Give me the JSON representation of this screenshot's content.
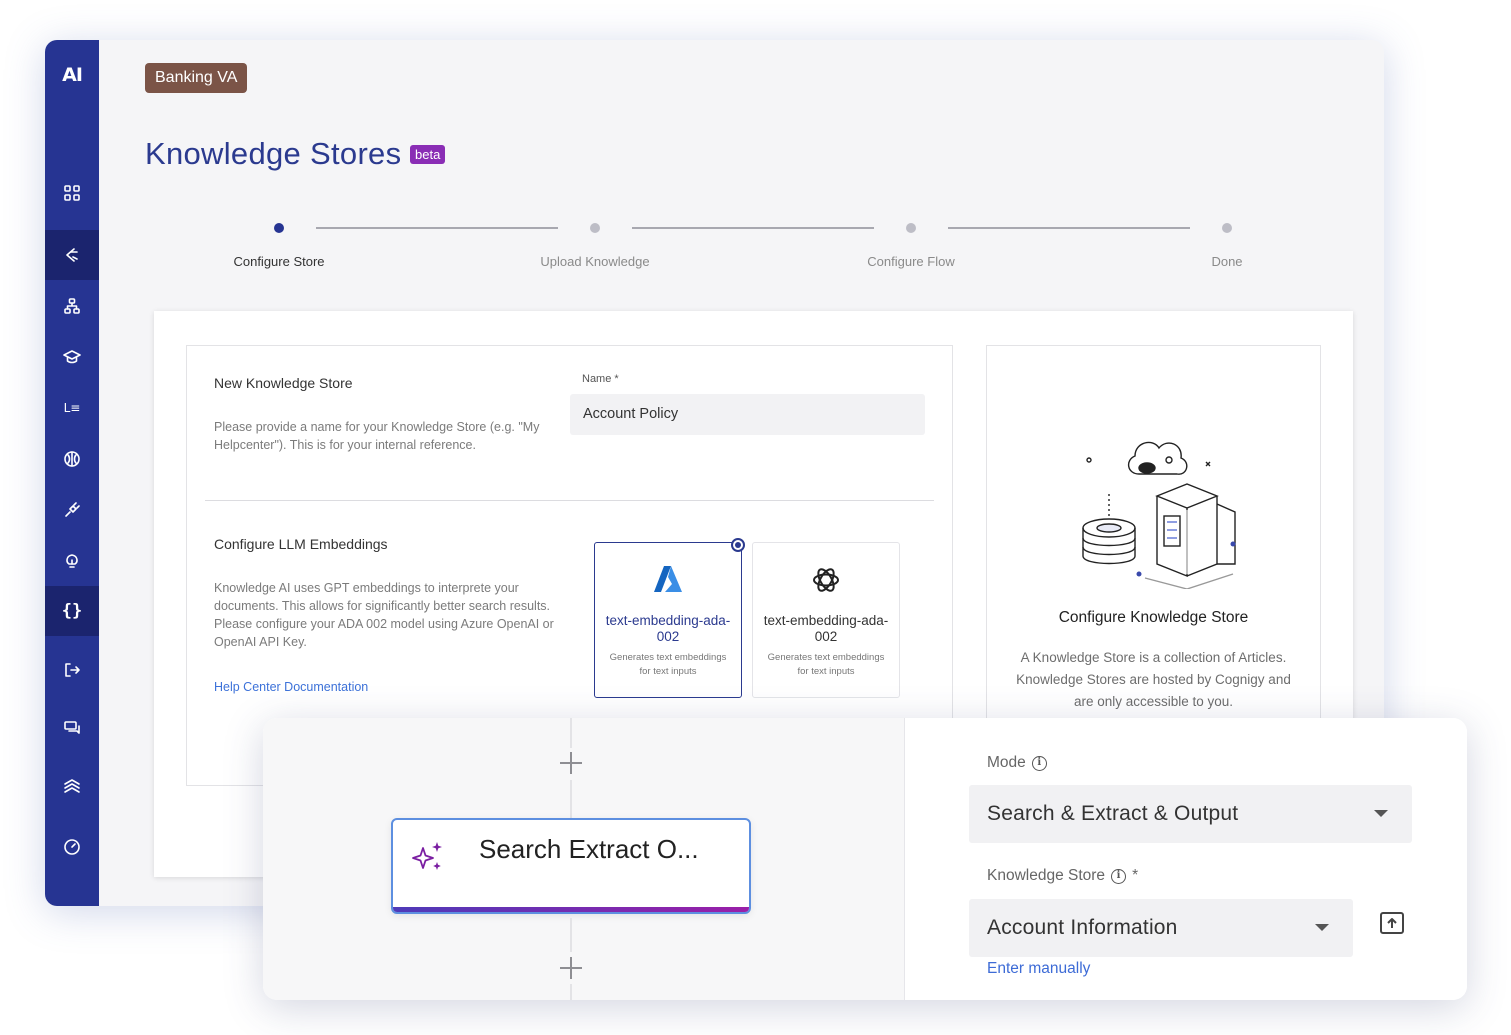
{
  "window": {
    "logo": "AI",
    "project_chip": "Banking VA",
    "page_title": "Knowledge Stores",
    "badge": "beta"
  },
  "sidebar": {
    "items": [
      {
        "icon": "grid-icon",
        "active": false
      },
      {
        "icon": "knowledge-icon",
        "active": true
      },
      {
        "icon": "flow-icon",
        "active": false
      },
      {
        "icon": "graduation-cap-icon",
        "active": false
      },
      {
        "icon": "list-icon",
        "active": false
      },
      {
        "icon": "brain-icon",
        "active": false
      },
      {
        "icon": "plug-icon",
        "active": false
      },
      {
        "icon": "lightbulb-icon",
        "active": false
      },
      {
        "icon": "braces-icon",
        "active": false
      },
      {
        "icon": "logout-icon",
        "active": false
      },
      {
        "icon": "chat-icon",
        "active": false
      },
      {
        "icon": "layers-icon",
        "active": false
      },
      {
        "icon": "gauge-icon",
        "active": false
      }
    ]
  },
  "stepper": {
    "steps": [
      {
        "label": "Configure Store",
        "active": true
      },
      {
        "label": "Upload Knowledge",
        "active": false
      },
      {
        "label": "Configure Flow",
        "active": false
      },
      {
        "label": "Done",
        "active": false
      }
    ]
  },
  "form": {
    "store_title": "New Knowledge Store",
    "store_desc": "Please provide a name for your Knowledge Store (e.g. \"My Helpcenter\"). This is for your internal reference.",
    "name_label": "Name *",
    "name_value": "Account Policy",
    "llm_title": "Configure LLM Embeddings",
    "llm_desc": "Knowledge AI uses GPT embeddings to interprete your documents. This allows for significantly better search results. Please configure your ADA 002 model using Azure OpenAI or OpenAI API Key.",
    "help_link": "Help Center Documentation",
    "models": [
      {
        "provider_icon": "azure-icon",
        "name": "text-embedding-ada-002",
        "desc": "Generates text embeddings for text inputs",
        "selected": true
      },
      {
        "provider_icon": "openai-icon",
        "name": "text-embedding-ada-002",
        "desc": "Generates text embeddings for text inputs",
        "selected": false
      }
    ]
  },
  "info": {
    "title": "Configure Knowledge Store",
    "desc": "A Knowledge Store is a collection of Articles. Knowledge Stores are hosted by Cognigy and are only accessible to you."
  },
  "overlay": {
    "node_title": "Search Extract O...",
    "mode_label": "Mode",
    "mode_value": "Search & Extract & Output",
    "store_label": "Knowledge Store",
    "store_required": "*",
    "store_value": "Account Information",
    "enter_manually": "Enter manually"
  },
  "colors": {
    "sidebar": "#263492",
    "accent": "#2b3a8f",
    "chip": "#7b5447",
    "beta": "#8a2db5",
    "link": "#3d72d9"
  }
}
